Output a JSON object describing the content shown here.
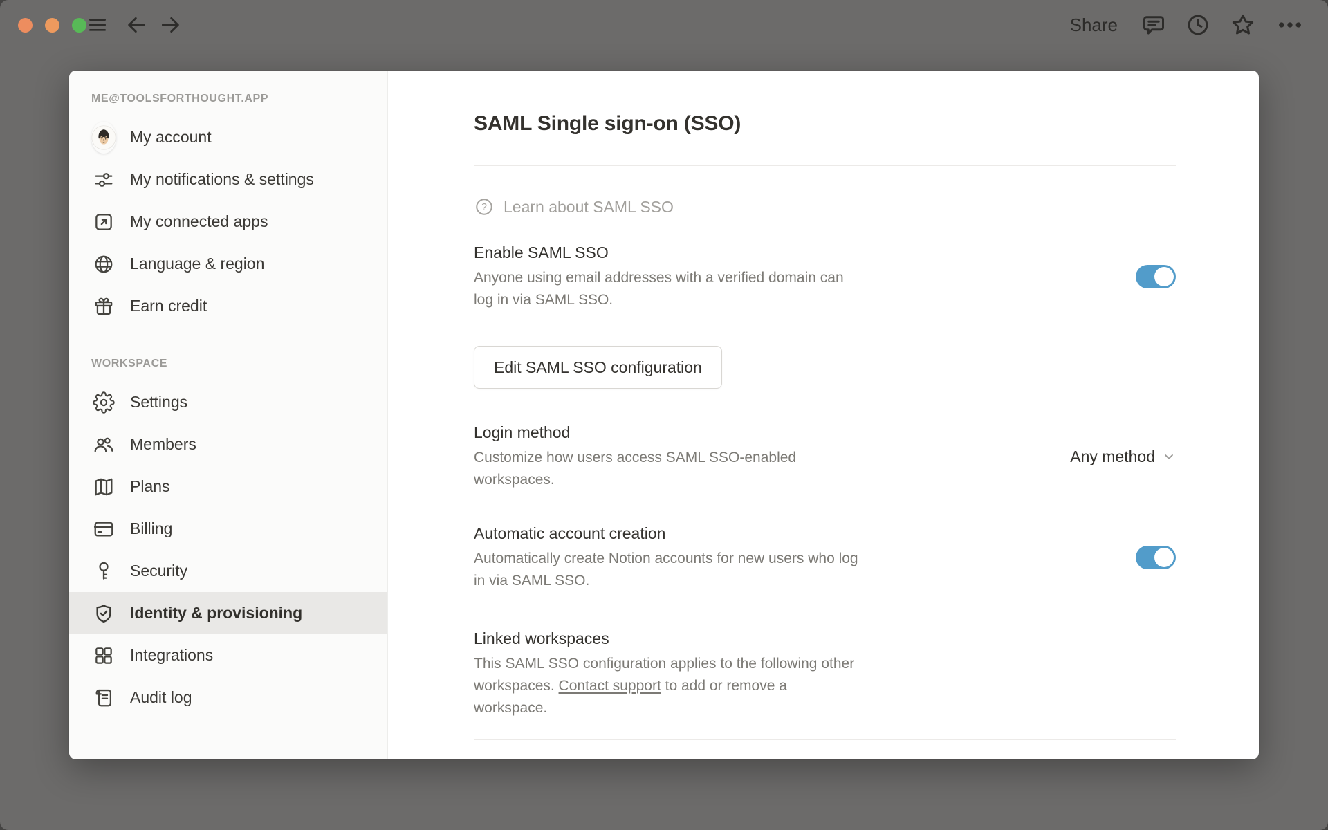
{
  "topbar": {
    "share_label": "Share"
  },
  "sidebar": {
    "account_header": "ME@TOOLSFORTHOUGHT.APP",
    "workspace_header": "WORKSPACE",
    "account_items": [
      {
        "label": "My account",
        "icon": "avatar"
      },
      {
        "label": "My notifications & settings",
        "icon": "sliders-icon"
      },
      {
        "label": "My connected apps",
        "icon": "arrow-out-box-icon"
      },
      {
        "label": "Language & region",
        "icon": "globe-icon"
      },
      {
        "label": "Earn credit",
        "icon": "gift-icon"
      }
    ],
    "workspace_items": [
      {
        "label": "Settings",
        "icon": "gear-icon",
        "selected": false
      },
      {
        "label": "Members",
        "icon": "members-icon",
        "selected": false
      },
      {
        "label": "Plans",
        "icon": "map-icon",
        "selected": false
      },
      {
        "label": "Billing",
        "icon": "credit-card-icon",
        "selected": false
      },
      {
        "label": "Security",
        "icon": "key-icon",
        "selected": false
      },
      {
        "label": "Identity & provisioning",
        "icon": "shield-check-icon",
        "selected": true
      },
      {
        "label": "Integrations",
        "icon": "grid-icon",
        "selected": false
      },
      {
        "label": "Audit log",
        "icon": "scroll-icon",
        "selected": false
      }
    ]
  },
  "main": {
    "title": "SAML Single sign-on (SSO)",
    "learn_label": "Learn about SAML SSO",
    "enable": {
      "title": "Enable SAML SSO",
      "description": "Anyone using email addresses with a verified domain can log in via SAML SSO.",
      "toggle_on": true
    },
    "edit_button_label": "Edit SAML SSO configuration",
    "login_method": {
      "title": "Login method",
      "description": "Customize how users access SAML SSO-enabled workspaces.",
      "value": "Any method"
    },
    "auto_account": {
      "title": "Automatic account creation",
      "description": "Automatically create Notion accounts for new users who log in via SAML SSO.",
      "toggle_on": true
    },
    "linked_workspaces": {
      "title": "Linked workspaces",
      "description_before_link": "This SAML SSO configuration applies to the following other workspaces. ",
      "link_text": "Contact support",
      "description_after_link": " to add or remove a workspace."
    }
  },
  "colors": {
    "accent_toggle_blue": "#529cca",
    "backdrop_gray": "#6c6b6a",
    "traffic_light_1": "#ed8d5f",
    "traffic_light_2": "#ed9a5e",
    "traffic_light_3": "#58b957",
    "sidebar_bg": "#fbfbfa",
    "selected_item_bg": "#e9e8e6"
  }
}
